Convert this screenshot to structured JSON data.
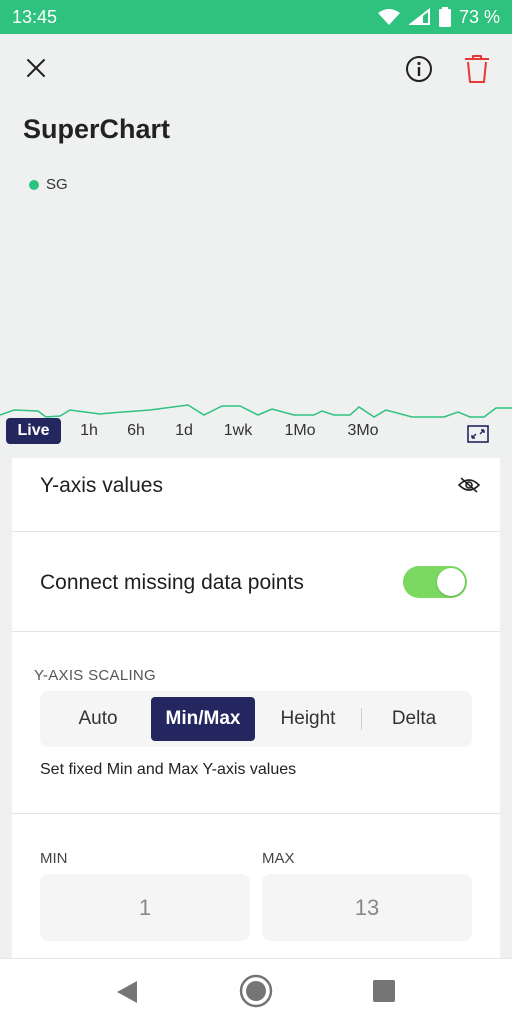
{
  "status_bar": {
    "time": "13:45",
    "battery_percent": "73 %"
  },
  "header": {
    "title": "SuperChart"
  },
  "legend": {
    "series_name": "SG",
    "series_color": "#2ec27e"
  },
  "time_ranges": [
    {
      "label": "Live",
      "active": true
    },
    {
      "label": "1h"
    },
    {
      "label": "6h"
    },
    {
      "label": "1d"
    },
    {
      "label": "1wk"
    },
    {
      "label": "1Mo"
    },
    {
      "label": "3Mo"
    }
  ],
  "settings": {
    "y_axis_values_label": "Y-axis values",
    "connect_missing_label": "Connect missing data points",
    "connect_missing_enabled": true,
    "y_axis_scaling_label": "Y-AXIS SCALING",
    "scaling_options": [
      "Auto",
      "Min/Max",
      "Height",
      "Delta"
    ],
    "scaling_selected": "Min/Max",
    "scaling_hint": "Set fixed Min and Max Y-axis values",
    "min_label": "MIN",
    "max_label": "MAX",
    "min_value": "1",
    "max_value": "13"
  },
  "colors": {
    "accent_green": "#2ec27e",
    "selected_navy": "#242660",
    "toggle_green": "#7bd860",
    "delete_red": "#e53935"
  }
}
